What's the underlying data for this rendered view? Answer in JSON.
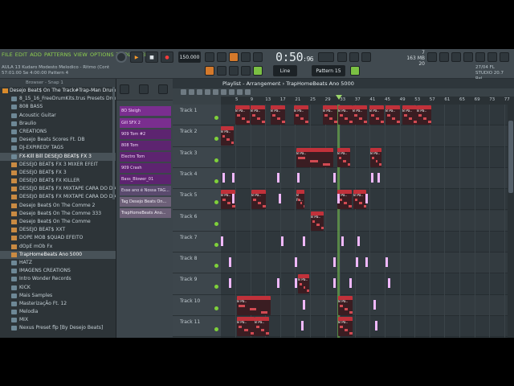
{
  "menu": [
    "FILE",
    "EDIT",
    "ADD",
    "PATTERNS",
    "VIEW",
    "OPTIONS",
    "TOOLS",
    "HELP"
  ],
  "song": {
    "title": "AULA 13 Kudaro Modesto Melodico - Ritmo (Cont",
    "position": "57:01:00",
    "length": "Se 4:00:00",
    "pattern_info": "Pattern 4"
  },
  "transport": {
    "play_icon": "play-icon",
    "stop_icon": "stop-icon",
    "record_icon": "record-icon",
    "tempo": "150.000",
    "time": "0:50",
    "time_fraction": "96"
  },
  "cpu": {
    "voices": "7",
    "memory": "163 MB",
    "polyphony": "20"
  },
  "studio": {
    "line1": "27/04 FL",
    "line2": "STUDIO 20.7 Rel..."
  },
  "snap": "Line",
  "pattern_selector": "Pattern 15",
  "browser": {
    "header": "Browser - Snap 1",
    "items": [
      {
        "label": "Desejo Beat$ On The Track#Trap-Man Drums",
        "type": "top"
      },
      {
        "label": "8_15_16_FreeDrumKits.trus Presets Drum Kit",
        "type": "folder"
      },
      {
        "label": "808 BASS",
        "type": "folder"
      },
      {
        "label": "Acoustic Guitar",
        "type": "folder"
      },
      {
        "label": "Braulio",
        "type": "folder"
      },
      {
        "label": "CREATIONS",
        "type": "folder"
      },
      {
        "label": "Desejo Beats Scores Ft. DB",
        "type": "folder"
      },
      {
        "label": "DJ-EXPIREDY TAGS",
        "type": "folder"
      },
      {
        "label": "FX-Kill Bill DESEJO BEAT$ FX 3",
        "type": "folder",
        "selected": true
      },
      {
        "label": "DESEJO BEAT$ FX 3 MIXER EFEIT",
        "type": "file"
      },
      {
        "label": "DESEJO BEAT$ FX 3",
        "type": "file"
      },
      {
        "label": "DESEJO BEAT$ FX KILLER",
        "type": "file"
      },
      {
        "label": "DESEJO BEAT$ FX MIXTAPE CARA DO DIABO 2",
        "type": "file"
      },
      {
        "label": "DESEJO BEAT$ FX MIXTAPE CARA DO DIABO",
        "type": "file"
      },
      {
        "label": "Desejo Beat$ On The Comme 2",
        "type": "file"
      },
      {
        "label": "Desejo Beat$ On The Comme 333",
        "type": "file"
      },
      {
        "label": "Desejo Beat$ On The Comme",
        "type": "file"
      },
      {
        "label": "DESEJO BEAT$ XXT",
        "type": "file"
      },
      {
        "label": "DOPE MOB $QUAD EFEITO",
        "type": "file"
      },
      {
        "label": "dOpE mOb Fx",
        "type": "file"
      },
      {
        "label": "TrapHomeBeats Ano 5000",
        "type": "file",
        "selected": true
      },
      {
        "label": "HATZ",
        "type": "folder"
      },
      {
        "label": "IMAGENS CREATIONS",
        "type": "folder"
      },
      {
        "label": "Intro Wonder Records",
        "type": "folder"
      },
      {
        "label": "KICK",
        "type": "folder"
      },
      {
        "label": "Mais Samples",
        "type": "folder"
      },
      {
        "label": "MasterizaçÃo Ft. 12",
        "type": "folder"
      },
      {
        "label": "Melodia",
        "type": "folder"
      },
      {
        "label": "MIX",
        "type": "folder"
      },
      {
        "label": "Nexus Preset flp [By Desejo Beats]",
        "type": "folder"
      }
    ]
  },
  "patterns": [
    {
      "label": "8O Sleigh",
      "kind": "purple"
    },
    {
      "label": "Gill SFX 2",
      "kind": "purple"
    },
    {
      "label": "909 Tom #2",
      "kind": "purple dark"
    },
    {
      "label": "808 Tom",
      "kind": "purple dark"
    },
    {
      "label": "Electro Tom",
      "kind": "purple dark"
    },
    {
      "label": "909 Crash",
      "kind": "purple dark"
    },
    {
      "label": "Bass_Blower_01",
      "kind": "purple dark"
    },
    {
      "label": "Esse ano é Nossa TAG...",
      "kind": "audio"
    },
    {
      "label": "Tag Desejo Beats On...",
      "kind": "audio2"
    },
    {
      "label": "TrapHomeBeats Ano...",
      "kind": "audio2"
    }
  ],
  "playlist": {
    "title_prefix": "Playlist - Arrangement",
    "title_arrow": "›",
    "title_name": "TrapHomeBeats Ano 5000",
    "ruler": [
      "5",
      "9",
      "13",
      "17",
      "21",
      "25",
      "29",
      "33",
      "37",
      "41",
      "45",
      "49",
      "53",
      "57",
      "61",
      "65",
      "69",
      "73",
      "77"
    ],
    "tracks": [
      "Track 1",
      "Track 2",
      "Track 3",
      "Track 4",
      "Track 5",
      "Track 6",
      "Track 7",
      "Track 8",
      "Track 9",
      "Track 10",
      "Track 11"
    ],
    "clip_label": "8 Pa.."
  },
  "colors": {
    "menu": "#8fd14f",
    "clip": "#c1313a",
    "pattern": "#7a2e8f",
    "note": "#f0b8ff"
  }
}
